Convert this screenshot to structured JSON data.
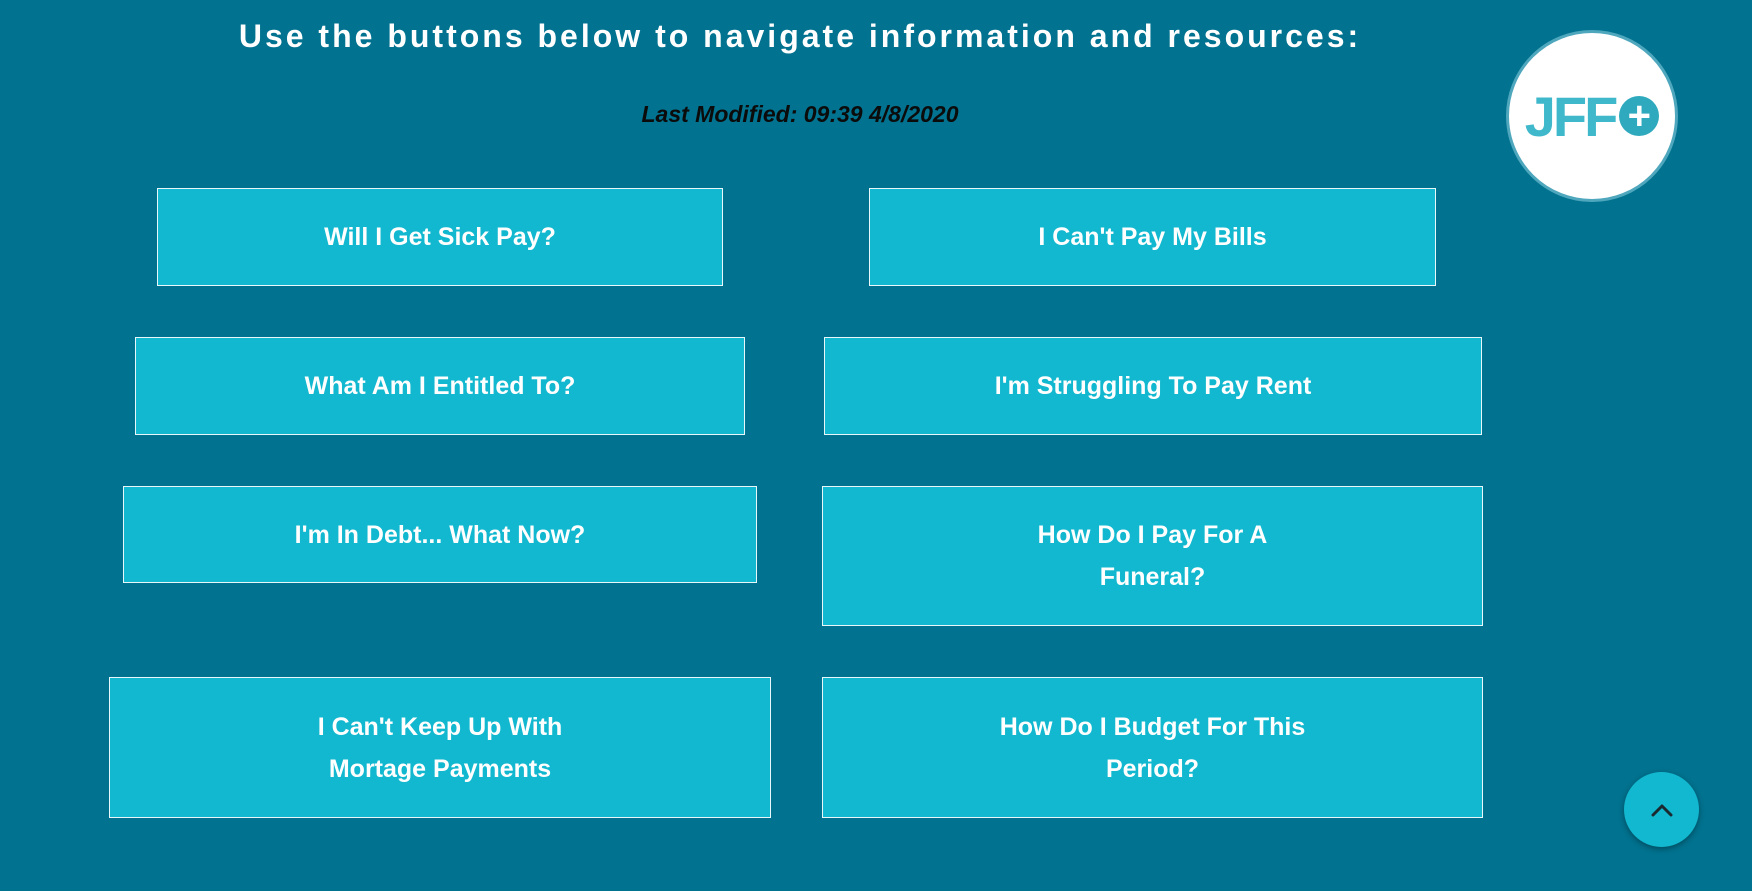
{
  "heading": "Use the buttons below to navigate information and resources:",
  "last_modified": "Last Modified: 09:39 4/8/2020",
  "logo": {
    "text": "JFF",
    "icon": "plus-circle-icon"
  },
  "buttons": {
    "sick_pay": "Will I Get Sick Pay?",
    "bills": "I Can't Pay My Bills",
    "entitled": "What Am I Entitled To?",
    "rent": "I'm Struggling To Pay Rent",
    "debt": "I'm In Debt... What Now?",
    "funeral": "How Do I Pay For A Funeral?",
    "mortgage": "I Can't Keep Up With Mortage Payments",
    "budget": "How Do I Budget For This Period?"
  },
  "back_to_top": {
    "icon": "chevron-up-icon"
  },
  "colors": {
    "background": "#01728f",
    "button": "#11b8cf",
    "text": "#ffffff"
  }
}
